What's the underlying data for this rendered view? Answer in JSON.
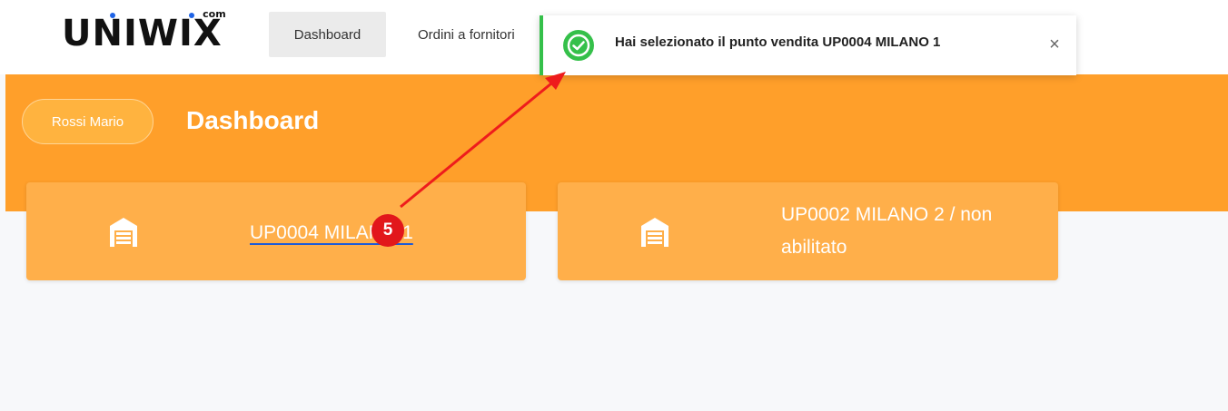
{
  "header": {
    "logo": "UNIWIX",
    "logo_suffix": "com",
    "nav": [
      {
        "label": "Dashboard",
        "active": true
      },
      {
        "label": "Ordini a fornitori"
      }
    ]
  },
  "banner": {
    "user_label": "Rossi Mario",
    "title": "Dashboard",
    "color": "#ff9f2a"
  },
  "stores": [
    {
      "label": "UP0004 MILANO 1",
      "icon": "store-icon"
    },
    {
      "label": "UP0002 MILANO 2 / non abilitato",
      "icon": "store-icon"
    }
  ],
  "toast": {
    "message": "Hai selezionato il punto vendita UP0004 MILANO 1",
    "icon": "check-circle-icon",
    "close_icon": "close-icon",
    "close_label": "×",
    "accent": "#35c04a"
  },
  "annotation": {
    "step": "5",
    "color": "#e2171b"
  }
}
